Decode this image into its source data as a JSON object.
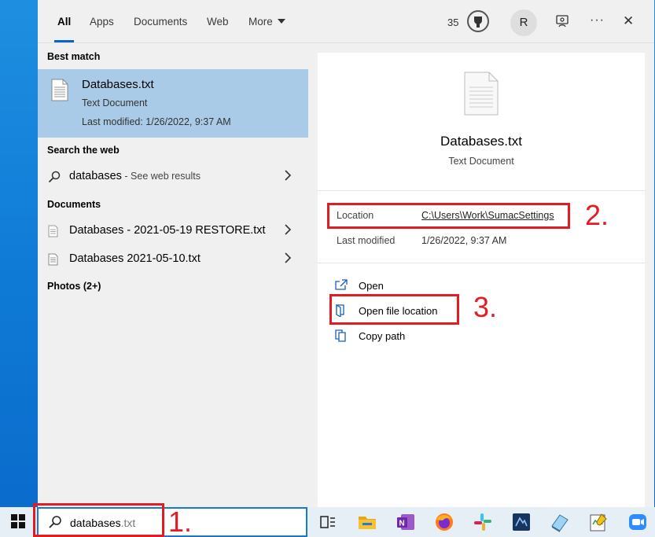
{
  "tabs": [
    "All",
    "Apps",
    "Documents",
    "Web",
    "More"
  ],
  "header": {
    "points": "35",
    "avatar": "R",
    "more_dots": "···",
    "close": "✕"
  },
  "left": {
    "best_match_label": "Best match",
    "best": {
      "name": "Databases.txt",
      "type": "Text Document",
      "modified": "Last modified: 1/26/2022, 9:37 AM"
    },
    "search_web_label": "Search the web",
    "web": {
      "query": "databases",
      "suffix": " - See web results"
    },
    "documents_label": "Documents",
    "docs": [
      "Databases - 2021-05-19 RESTORE.txt",
      "Databases 2021-05-10.txt"
    ],
    "photos_label": "Photos (2+)"
  },
  "preview": {
    "title": "Databases.txt",
    "type": "Text Document",
    "location_label": "Location",
    "location_value": "C:\\Users\\Work\\SumacSettings",
    "modified_label": "Last modified",
    "modified_value": "1/26/2022, 9:37 AM",
    "actions": [
      "Open",
      "Open file location",
      "Copy path"
    ]
  },
  "annotations": [
    "1.",
    "2.",
    "3."
  ],
  "taskbar": {
    "query": "databases",
    "query_suffix": ".txt"
  },
  "colors": {
    "accent": "#0a63c9",
    "selection": "#a9cbe8",
    "annotation": "#e31c23"
  }
}
